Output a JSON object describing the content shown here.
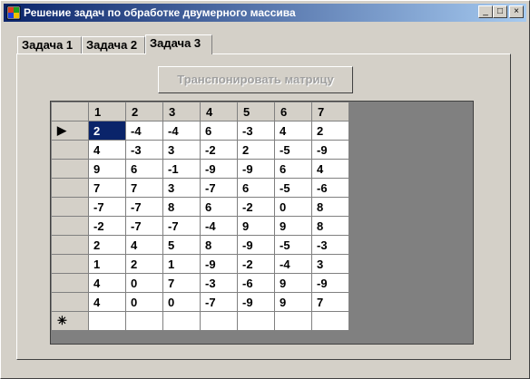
{
  "window": {
    "title": "Решение задач по обработке двумерного массива",
    "min_icon": "_",
    "max_icon": "□",
    "close_icon": "×"
  },
  "tabs": [
    {
      "label": "Задача 1"
    },
    {
      "label": "Задача 2"
    },
    {
      "label": "Задача 3"
    }
  ],
  "transpose_button": "Транспонировать матрицу",
  "grid": {
    "columns": [
      "1",
      "2",
      "3",
      "4",
      "5",
      "6",
      "7"
    ],
    "current_row_marker": "▶",
    "new_row_marker": "✳",
    "rows": [
      [
        "2",
        "-4",
        "-4",
        "6",
        "-3",
        "4",
        "2"
      ],
      [
        "4",
        "-3",
        "3",
        "-2",
        "2",
        "-5",
        "-9"
      ],
      [
        "9",
        "6",
        "-1",
        "-9",
        "-9",
        "6",
        "4"
      ],
      [
        "7",
        "7",
        "3",
        "-7",
        "6",
        "-5",
        "-6"
      ],
      [
        "-7",
        "-7",
        "8",
        "6",
        "-2",
        "0",
        "8"
      ],
      [
        "-2",
        "-7",
        "-7",
        "-4",
        "9",
        "9",
        "8"
      ],
      [
        "2",
        "4",
        "5",
        "8",
        "-9",
        "-5",
        "-3"
      ],
      [
        "1",
        "2",
        "1",
        "-9",
        "-2",
        "-4",
        "3"
      ],
      [
        "4",
        "0",
        "7",
        "-3",
        "-6",
        "9",
        "-9"
      ],
      [
        "4",
        "0",
        "0",
        "-7",
        "-9",
        "9",
        "7"
      ]
    ]
  }
}
